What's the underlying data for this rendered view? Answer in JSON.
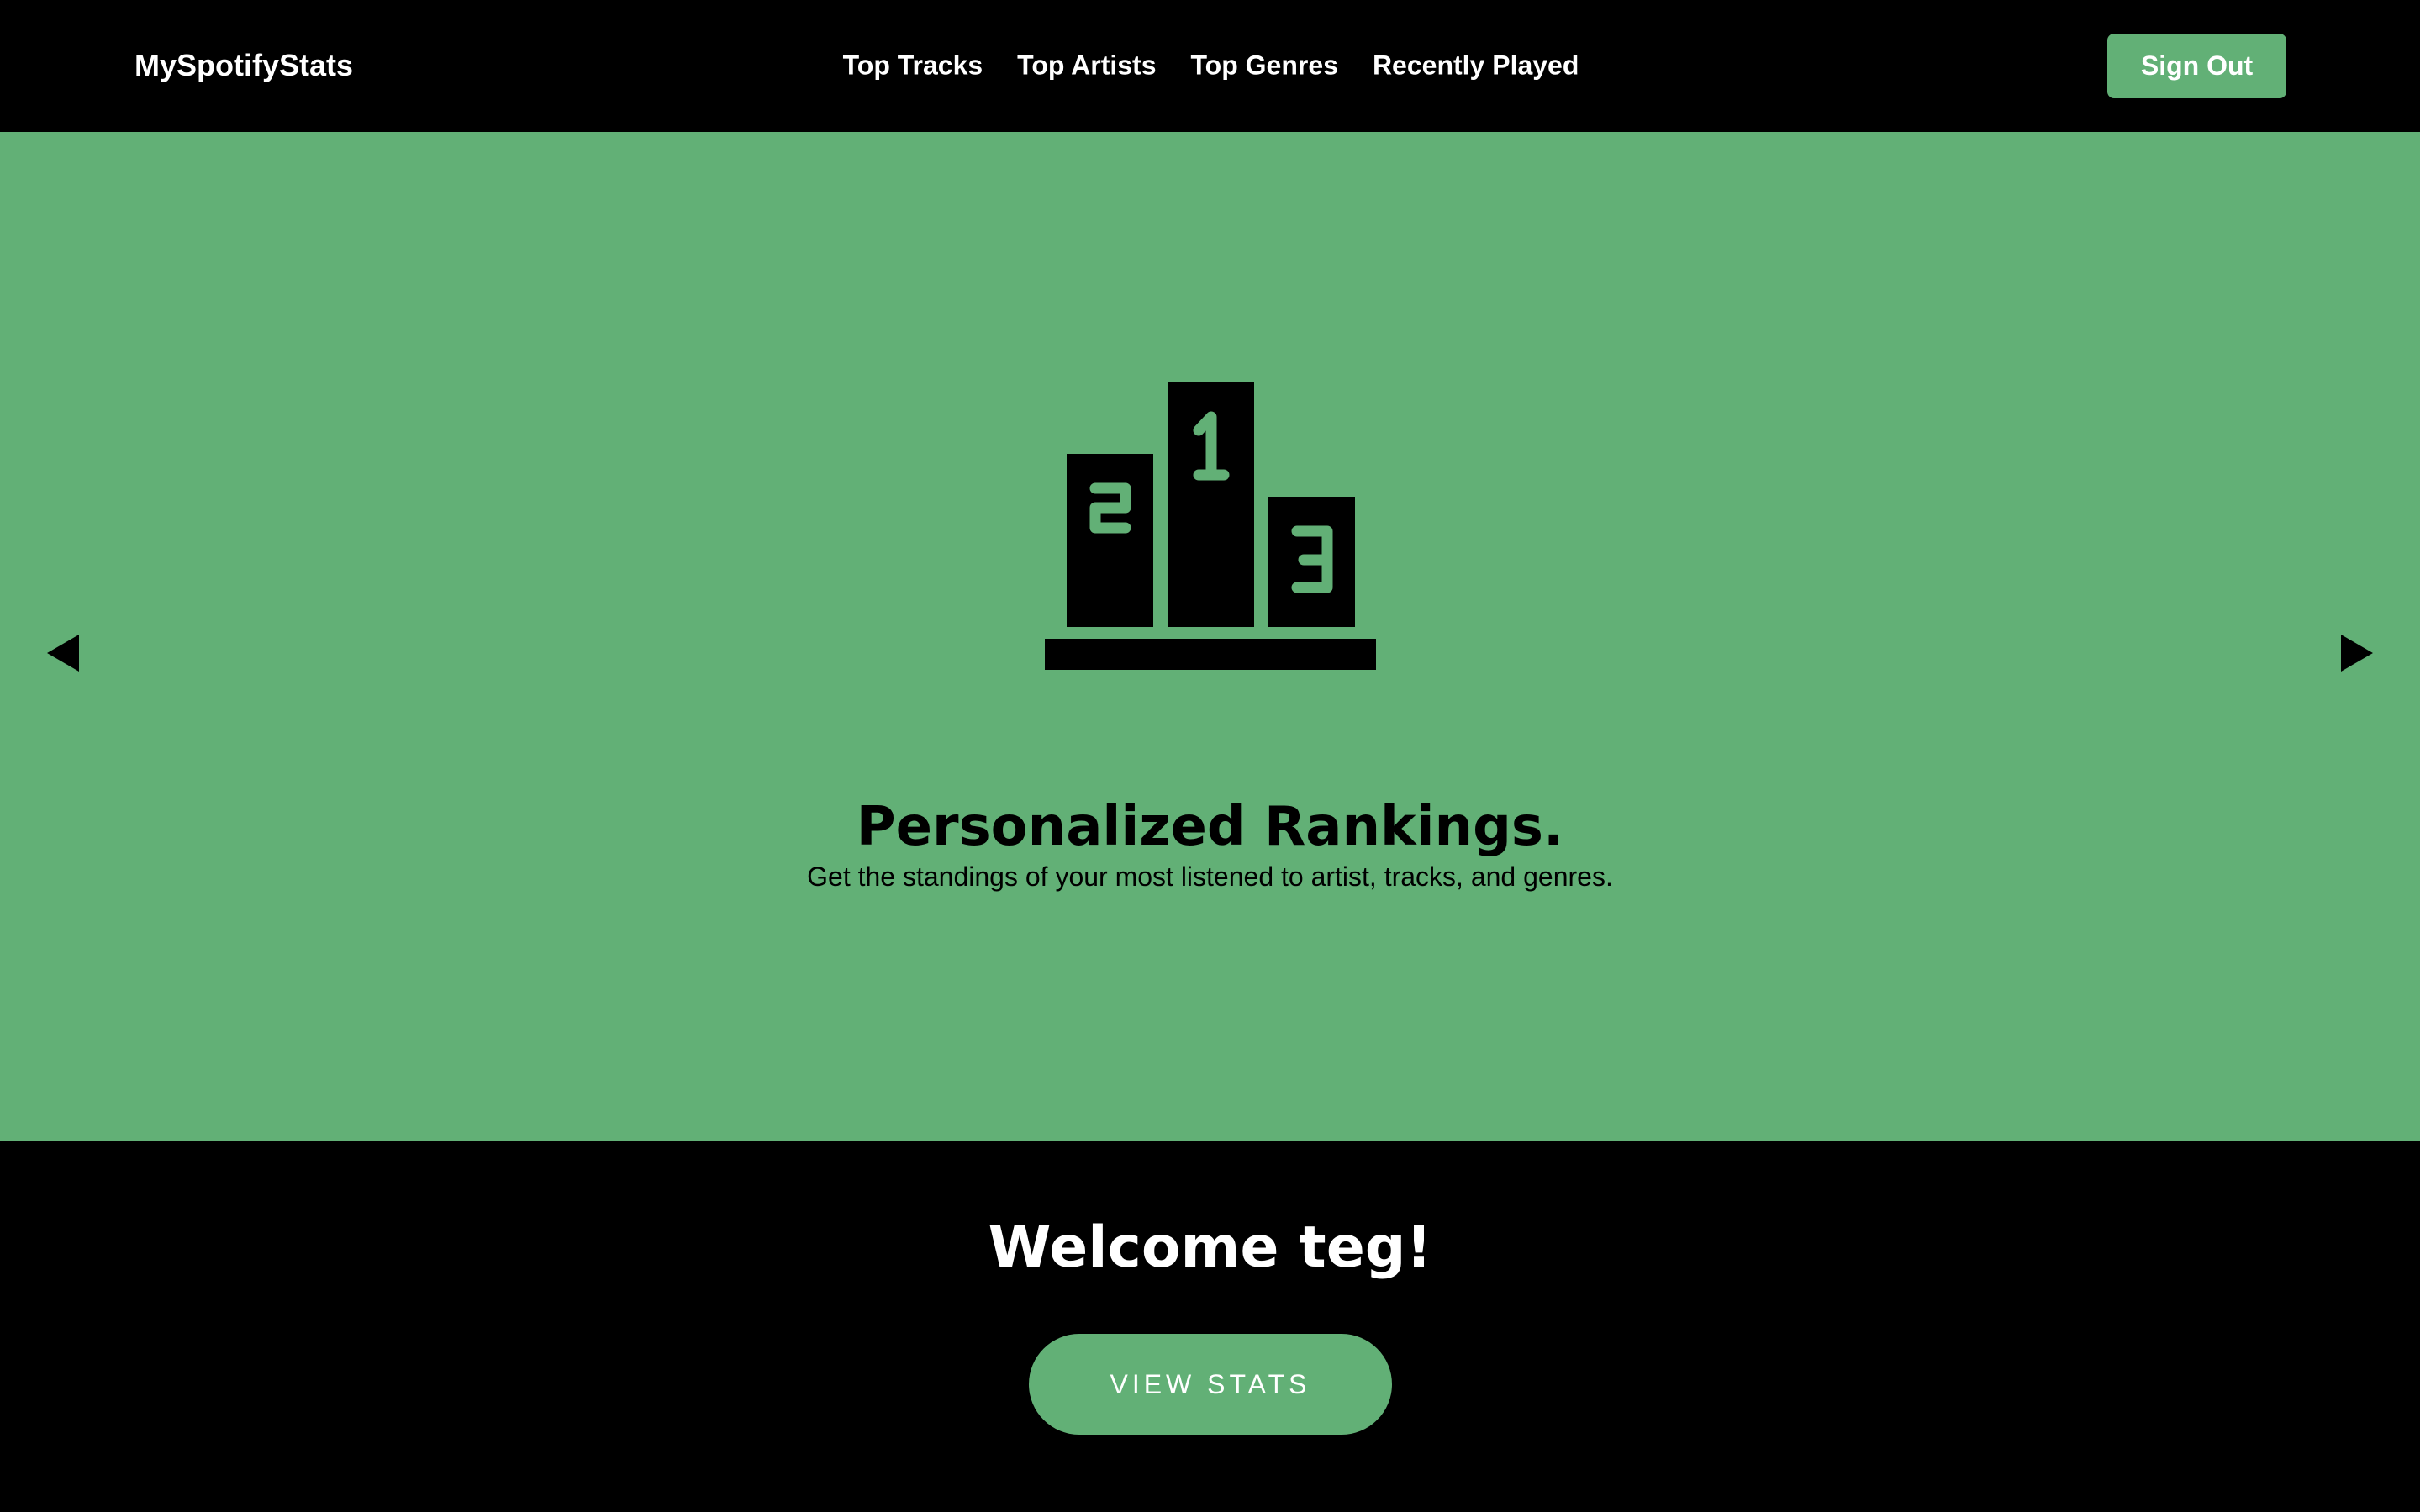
{
  "nav": {
    "brand": "MySpotifyStats",
    "links": [
      "Top Tracks",
      "Top Artists",
      "Top Genres",
      "Recently Played"
    ],
    "sign_out_label": "Sign Out"
  },
  "hero": {
    "icon": "podium-icon",
    "title": "Personalized Rankings.",
    "subtitle": "Get the standings of your most listened to artist, tracks, and genres.",
    "prev_icon": "arrow-left-icon",
    "next_icon": "arrow-right-icon"
  },
  "welcome": {
    "title": "Welcome teg!",
    "cta_label": "VIEW STATS"
  },
  "colors": {
    "accent": "#62b076",
    "background": "#000000",
    "text_light": "#ffffff",
    "text_dark": "#000000"
  }
}
